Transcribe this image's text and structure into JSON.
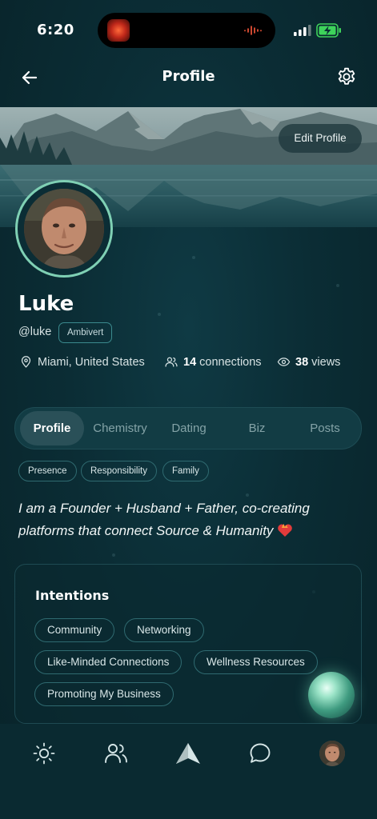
{
  "status_bar": {
    "time": "6:20"
  },
  "header": {
    "title": "Profile"
  },
  "cover": {
    "edit_label": "Edit Profile"
  },
  "profile": {
    "name": "Luke",
    "handle": "@luke",
    "personality": "Ambivert",
    "location": "Miami, United States",
    "connections_count": "14",
    "connections_label": "connections",
    "views_count": "38",
    "views_label": "views"
  },
  "tabs": [
    {
      "label": "Profile",
      "active": true
    },
    {
      "label": "Chemistry",
      "active": false
    },
    {
      "label": "Dating",
      "active": false
    },
    {
      "label": "Biz",
      "active": false
    },
    {
      "label": "Posts",
      "active": false
    }
  ],
  "values_chips": [
    "Presence",
    "Responsibility",
    "Family"
  ],
  "bio": {
    "line1": "I am a Founder + Husband + Father, co-creating",
    "line2": "platforms that connect Source & Humanity"
  },
  "intentions": {
    "title": "Intentions",
    "items": [
      "Community",
      "Networking",
      "Like-Minded Connections",
      "Wellness Resources",
      "Promoting My Business"
    ]
  },
  "bottom_nav": {
    "items": [
      {
        "icon": "sun-icon"
      },
      {
        "icon": "people-icon"
      },
      {
        "icon": "compass-arrow-icon"
      },
      {
        "icon": "chat-bubble-icon"
      },
      {
        "icon": "profile-avatar"
      }
    ]
  },
  "colors": {
    "background": "#0b2d35",
    "accent_ring": "#7fd0b4",
    "chip_border": "#2f6a70",
    "tab_active": "#2a5058"
  }
}
